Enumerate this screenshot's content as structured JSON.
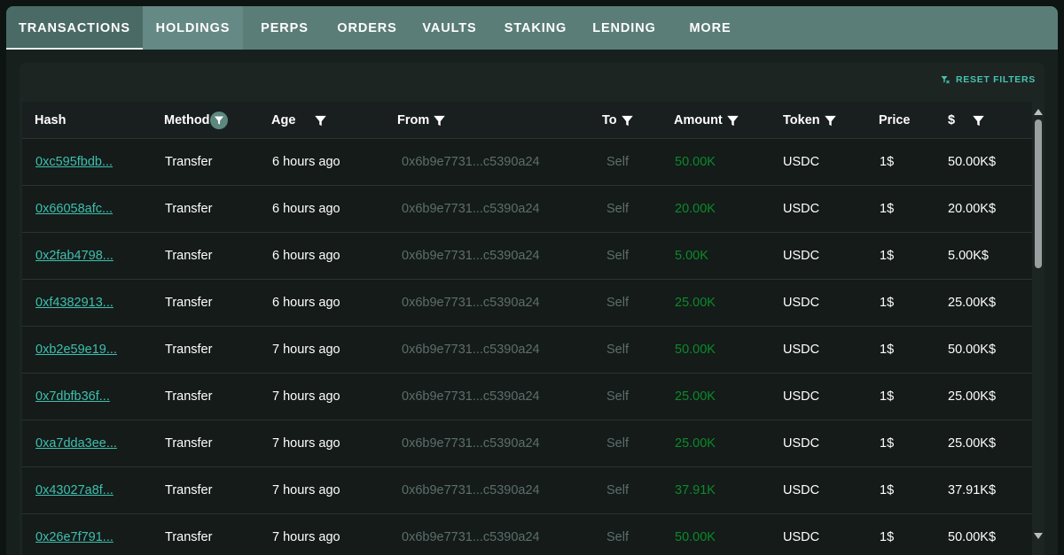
{
  "tabs": [
    {
      "label": "TRANSACTIONS",
      "active": true
    },
    {
      "label": "HOLDINGS",
      "active": false
    },
    {
      "label": "PERPS",
      "active": false
    },
    {
      "label": "ORDERS",
      "active": false
    },
    {
      "label": "VAULTS",
      "active": false
    },
    {
      "label": "STAKING",
      "active": false
    },
    {
      "label": "LENDING",
      "active": false
    },
    {
      "label": "MORE",
      "active": false
    }
  ],
  "reset_filters_label": "RESET FILTERS",
  "columns": {
    "hash": "Hash",
    "method": "Method",
    "age": "Age",
    "from": "From",
    "to": "To",
    "amount": "Amount",
    "token": "Token",
    "price": "Price",
    "usd": "$"
  },
  "rows": [
    {
      "hash": "0xc595fbdb...",
      "method": "Transfer",
      "age": "6 hours ago",
      "from": "0x6b9e7731...c5390a24",
      "to": "Self",
      "amount": "50.00K",
      "token": "USDC",
      "price": "1$",
      "usd": "50.00K$"
    },
    {
      "hash": "0x66058afc...",
      "method": "Transfer",
      "age": "6 hours ago",
      "from": "0x6b9e7731...c5390a24",
      "to": "Self",
      "amount": "20.00K",
      "token": "USDC",
      "price": "1$",
      "usd": "20.00K$"
    },
    {
      "hash": "0x2fab4798...",
      "method": "Transfer",
      "age": "6 hours ago",
      "from": "0x6b9e7731...c5390a24",
      "to": "Self",
      "amount": "5.00K",
      "token": "USDC",
      "price": "1$",
      "usd": "5.00K$"
    },
    {
      "hash": "0xf4382913...",
      "method": "Transfer",
      "age": "6 hours ago",
      "from": "0x6b9e7731...c5390a24",
      "to": "Self",
      "amount": "25.00K",
      "token": "USDC",
      "price": "1$",
      "usd": "25.00K$"
    },
    {
      "hash": "0xb2e59e19...",
      "method": "Transfer",
      "age": "7 hours ago",
      "from": "0x6b9e7731...c5390a24",
      "to": "Self",
      "amount": "50.00K",
      "token": "USDC",
      "price": "1$",
      "usd": "50.00K$"
    },
    {
      "hash": "0x7dbfb36f...",
      "method": "Transfer",
      "age": "7 hours ago",
      "from": "0x6b9e7731...c5390a24",
      "to": "Self",
      "amount": "25.00K",
      "token": "USDC",
      "price": "1$",
      "usd": "25.00K$"
    },
    {
      "hash": "0xa7dda3ee...",
      "method": "Transfer",
      "age": "7 hours ago",
      "from": "0x6b9e7731...c5390a24",
      "to": "Self",
      "amount": "25.00K",
      "token": "USDC",
      "price": "1$",
      "usd": "25.00K$"
    },
    {
      "hash": "0x43027a8f...",
      "method": "Transfer",
      "age": "7 hours ago",
      "from": "0x6b9e7731...c5390a24",
      "to": "Self",
      "amount": "37.91K",
      "token": "USDC",
      "price": "1$",
      "usd": "37.91K$"
    },
    {
      "hash": "0x26e7f791...",
      "method": "Transfer",
      "age": "7 hours ago",
      "from": "0x6b9e7731...c5390a24",
      "to": "Self",
      "amount": "50.00K",
      "token": "USDC",
      "price": "1$",
      "usd": "50.00K$"
    }
  ],
  "colors": {
    "tab_bar": "#5a7d77",
    "link": "#3fbfae",
    "amount": "#0c8a2a",
    "muted": "#5d6e6b"
  },
  "icons": {
    "filter": "filter-funnel-icon",
    "reset": "filter-reset-icon",
    "scroll_up": "chevron-up-icon",
    "scroll_down": "chevron-down-icon"
  }
}
